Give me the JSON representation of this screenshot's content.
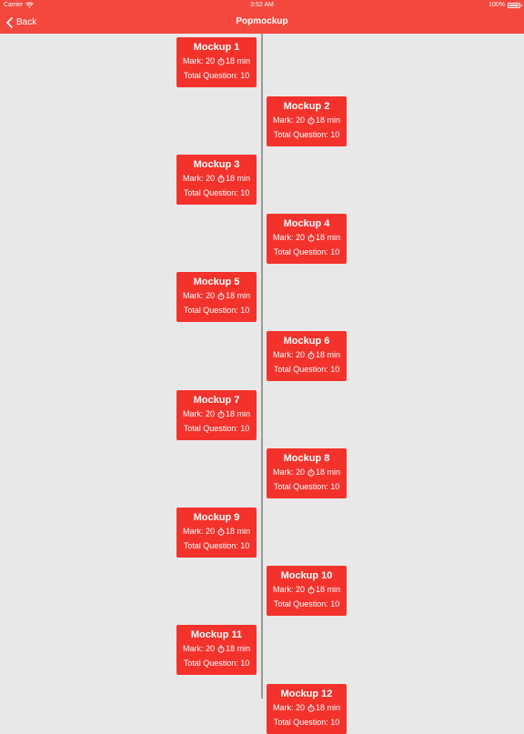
{
  "status_bar": {
    "carrier": "Carrier",
    "time": "3:52 AM",
    "battery": "100%",
    "battery_level": 1.0
  },
  "nav": {
    "back_label": "Back",
    "title": "Popmockup"
  },
  "mockups": [
    {
      "title": "Mockup 1",
      "mark": "Mark: 20",
      "time": "18 min",
      "questions": "Total Question: 10"
    },
    {
      "title": "Mockup 2",
      "mark": "Mark: 20",
      "time": "18 min",
      "questions": "Total Question: 10"
    },
    {
      "title": "Mockup 3",
      "mark": "Mark: 20",
      "time": "18 min",
      "questions": "Total Question: 10"
    },
    {
      "title": "Mockup 4",
      "mark": "Mark: 20",
      "time": "18 min",
      "questions": "Total Question: 10"
    },
    {
      "title": "Mockup 5",
      "mark": "Mark: 20",
      "time": "18 min",
      "questions": "Total Question: 10"
    },
    {
      "title": "Mockup 6",
      "mark": "Mark: 20",
      "time": "18 min",
      "questions": "Total Question: 10"
    },
    {
      "title": "Mockup 7",
      "mark": "Mark: 20",
      "time": "18 min",
      "questions": "Total Question: 10"
    },
    {
      "title": "Mockup 8",
      "mark": "Mark: 20",
      "time": "18 min",
      "questions": "Total Question: 10"
    },
    {
      "title": "Mockup 9",
      "mark": "Mark: 20",
      "time": "18 min",
      "questions": "Total Question: 10"
    },
    {
      "title": "Mockup 10",
      "mark": "Mark: 20",
      "time": "18 min",
      "questions": "Total Question: 10"
    },
    {
      "title": "Mockup 11",
      "mark": "Mark: 20",
      "time": "18 min",
      "questions": "Total Question: 10"
    },
    {
      "title": "Mockup 12",
      "mark": "Mark: 20",
      "time": "18 min",
      "questions": "Total Question: 10"
    }
  ],
  "colors": {
    "accent": "#f4483f",
    "card": "#f4322c",
    "background": "#e9e8e9",
    "timeline": "#9a9a9a"
  },
  "icons": {
    "back": "chevron-left-icon",
    "timer": "stopwatch-icon",
    "wifi": "wifi-icon",
    "battery": "battery-icon"
  }
}
